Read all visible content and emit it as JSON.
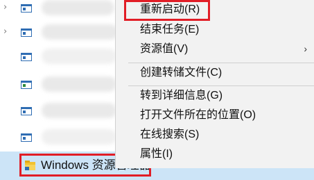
{
  "process_list": {
    "rows": [
      {
        "expandable": true,
        "icon": "app-window-icon"
      },
      {
        "expandable": true,
        "icon": "app-window-icon"
      },
      {
        "expandable": false,
        "icon": "app-window-icon"
      },
      {
        "expandable": false,
        "icon": "app-window-icon-green"
      },
      {
        "expandable": false,
        "icon": "app-window-icon"
      },
      {
        "expandable": false,
        "icon": "app-window-icon"
      }
    ],
    "selected": {
      "label": "Windows 资源管理器",
      "icon": "folder-icon"
    }
  },
  "context_menu": {
    "items": [
      {
        "label": "重新启动(R)",
        "highlighted": true
      },
      {
        "label": "结束任务(E)"
      },
      {
        "label": "资源值(V)",
        "submenu_arrow": "›"
      },
      {
        "label": "创建转储文件(C)"
      },
      {
        "label": "转到详细信息(G)"
      },
      {
        "label": "打开文件所在的位置(O)"
      },
      {
        "label": "在线搜索(S)"
      },
      {
        "label": "属性(I)"
      }
    ]
  },
  "colors": {
    "highlight_box": "#e11d26",
    "selected_row": "#cce4f7",
    "menu_background": "#f2f2f2",
    "icon_blue": "#2f6db3"
  },
  "glyphs": {
    "chevron": "›"
  }
}
